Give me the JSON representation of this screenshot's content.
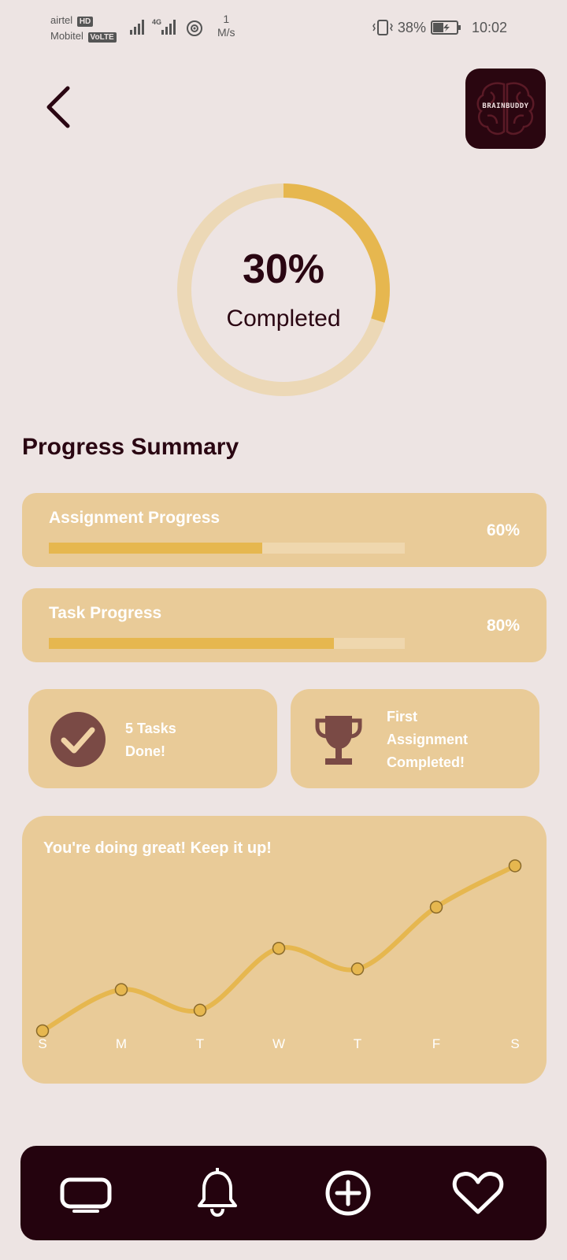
{
  "status_bar": {
    "carrier1": "airtel",
    "carrier1_tag": "HD",
    "carrier2": "Mobitel",
    "carrier2_tag": "VoLTE",
    "network": "4G",
    "speed_value": "1",
    "speed_unit": "M/s",
    "battery": "38%",
    "time": "10:02"
  },
  "header": {
    "back_icon": "chevron-left-icon",
    "logo_text": "BRAINBUDDY"
  },
  "overall": {
    "percent_label": "30%",
    "caption": "Completed",
    "percent_value": 30
  },
  "summary": {
    "title": "Progress Summary",
    "items": [
      {
        "label": "Assignment Progress",
        "percent_label": "60%",
        "percent_value": 60
      },
      {
        "label": "Task Progress",
        "percent_label": "80%",
        "percent_value": 80
      }
    ]
  },
  "achievements": [
    {
      "icon": "check-circle-icon",
      "text": [
        "5 Tasks",
        "Done!"
      ]
    },
    {
      "icon": "trophy-icon",
      "text": [
        "First",
        "Assignment",
        "Completed!"
      ]
    }
  ],
  "chart_data": {
    "type": "line",
    "title": "You're doing great! Keep it up!",
    "categories": [
      "S",
      "M",
      "T",
      "W",
      "T",
      "F",
      "S"
    ],
    "series": [
      {
        "values": [
          0,
          2,
          1,
          4,
          3,
          6,
          8
        ]
      }
    ],
    "ylim": [
      0,
      8.4
    ],
    "grid": false
  },
  "bottom_nav": {
    "items": [
      {
        "icon": "tv-icon"
      },
      {
        "icon": "bell-icon"
      },
      {
        "icon": "add-circle-icon"
      },
      {
        "icon": "heart-icon"
      }
    ]
  },
  "colors": {
    "background": "#ede4e3",
    "card": "#e9cb98",
    "accent": "#e6b74f",
    "dark": "#24030e",
    "badge": "#7a4a45"
  }
}
